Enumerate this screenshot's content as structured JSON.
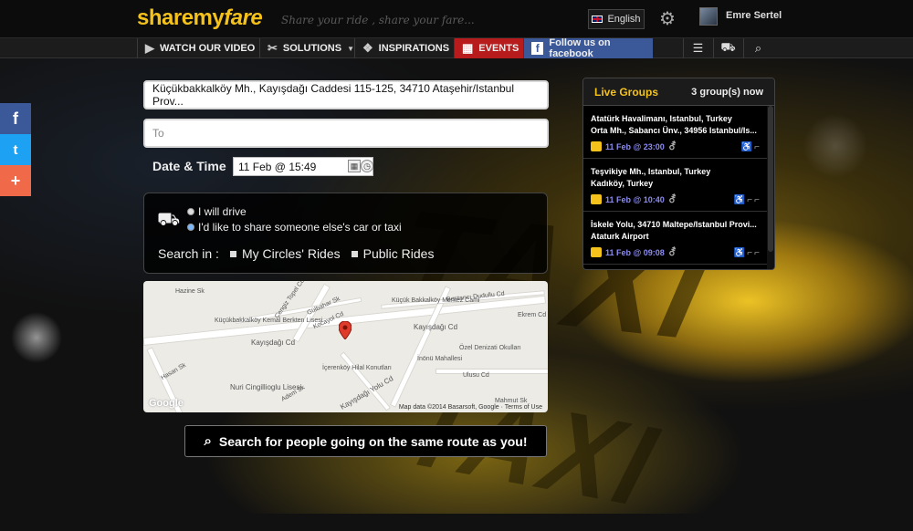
{
  "header": {
    "logo_a": "sharemy",
    "logo_b": "fare",
    "tagline": "Share your ride , share your fare...",
    "language": "English",
    "user_name": "Emre Sertel"
  },
  "nav": {
    "items": [
      "WATCH OUR VIDEO",
      "SOLUTIONS",
      "INSPIRATIONS",
      "EVENTS",
      "Follow us on facebook"
    ]
  },
  "form": {
    "from_value": "Küçükbakkalköy Mh., Kayışdağı Caddesi 115-125, 34710 Ataşehir/Istanbul Prov...",
    "to_placeholder": "To",
    "datetime_label": "Date & Time",
    "datetime_value": "11 Feb @ 15:49",
    "option_drive": "I will drive",
    "option_share": "I'd like to share someone else's car or taxi",
    "search_in_label": "Search in :",
    "scope_circles": "My Circles' Rides",
    "scope_public": "Public Rides",
    "search_button": "Search for people going on the same route as you!"
  },
  "map": {
    "labels": [
      "Hazine Sk",
      "Cengiz Topel Cd",
      "Gülbahar Sk",
      "Küçük Bakkalköy Merkez Cami",
      "Bostancı Dudullu Cd",
      "Kocayol Cd",
      "Küçükbakkalköy Kemal Berkten Lisesi",
      "Kayışdağı Cd",
      "Ekrem Cd",
      "Kayışdağı Cd",
      "İnönü Mahallesi",
      "Özel Denizati Okulları",
      "Ulusu Cd",
      "İçerenköy Hilal Konutları",
      "Kayışdağı Yolu Cd",
      "Nuri Cingillioglu Lisesi",
      "Adem Sk",
      "Hasan Sk",
      "Mahmut Sk"
    ],
    "attribution": "Map data ©2014 Basarsoft, Google · Terms of Use",
    "brand": "Google"
  },
  "live_groups": {
    "title": "Live Groups",
    "count": "3 group(s) now",
    "groups": [
      {
        "line1": "Atatürk Havalimanı, Istanbul, Turkey",
        "line2": "Orta Mh., Sabancı Ünv., 34956 Istanbul/Is...",
        "time": "11 Feb @ 23:00"
      },
      {
        "line1": "Teşvikiye Mh., Istanbul, Turkey",
        "line2": "Kadıköy, Turkey",
        "time": "11 Feb @ 10:40"
      },
      {
        "line1": "İskele Yolu, 34710 Maltepe/Istanbul Provi...",
        "line2": "Ataturk Airport",
        "time": "11 Feb @ 09:08"
      }
    ]
  },
  "colors": {
    "brand": "#f4c21b",
    "events": "#b81b1b",
    "facebook": "#3b5998",
    "twitter": "#1da1f2",
    "plus": "#f06a4a"
  }
}
